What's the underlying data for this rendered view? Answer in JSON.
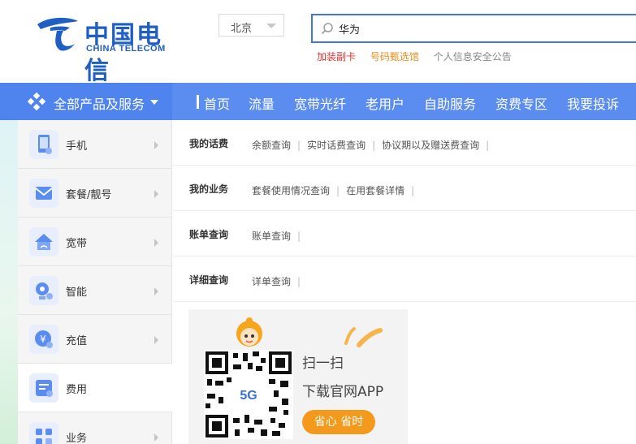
{
  "brand": {
    "name_cn": "中国电信",
    "name_en": "CHINA TELECOM",
    "color": "#1f5fc4"
  },
  "city_selector": {
    "value": "北京"
  },
  "search": {
    "value": "华为"
  },
  "hot_links": [
    "加装副卡",
    "号码甄选馆",
    "个人信息安全公告"
  ],
  "nav": {
    "all_products": "全部产品及服务",
    "items": [
      "首页",
      "流量",
      "宽带光纤",
      "老用户",
      "自助服务",
      "资费专区",
      "我要投诉"
    ],
    "color": "#5b8df0"
  },
  "sidebar": {
    "items": [
      {
        "label": "手机",
        "icon": "phone-icon"
      },
      {
        "label": "套餐/靓号",
        "icon": "package-icon"
      },
      {
        "label": "宽带",
        "icon": "broadband-icon"
      },
      {
        "label": "智能",
        "icon": "smart-icon"
      },
      {
        "label": "充值",
        "icon": "recharge-icon"
      },
      {
        "label": "费用",
        "icon": "bill-icon"
      },
      {
        "label": "业务",
        "icon": "business-icon"
      }
    ],
    "active_index": 5
  },
  "content": {
    "rows": [
      {
        "title": "我的话费",
        "links": [
          "余额查询",
          "实时话费查询",
          "协议期以及赠送费查询"
        ]
      },
      {
        "title": "我的业务",
        "links": [
          "套餐使用情况查询",
          "在用套餐详情"
        ]
      },
      {
        "title": "账单查询",
        "links": [
          "账单查询"
        ]
      },
      {
        "title": "详细查询",
        "links": [
          "详单查询"
        ]
      }
    ]
  },
  "promo": {
    "scan": "扫一扫",
    "download": "下载官网APP",
    "badge": "省心 省时",
    "qr_label": "5G",
    "accent": "#f39a1d"
  }
}
